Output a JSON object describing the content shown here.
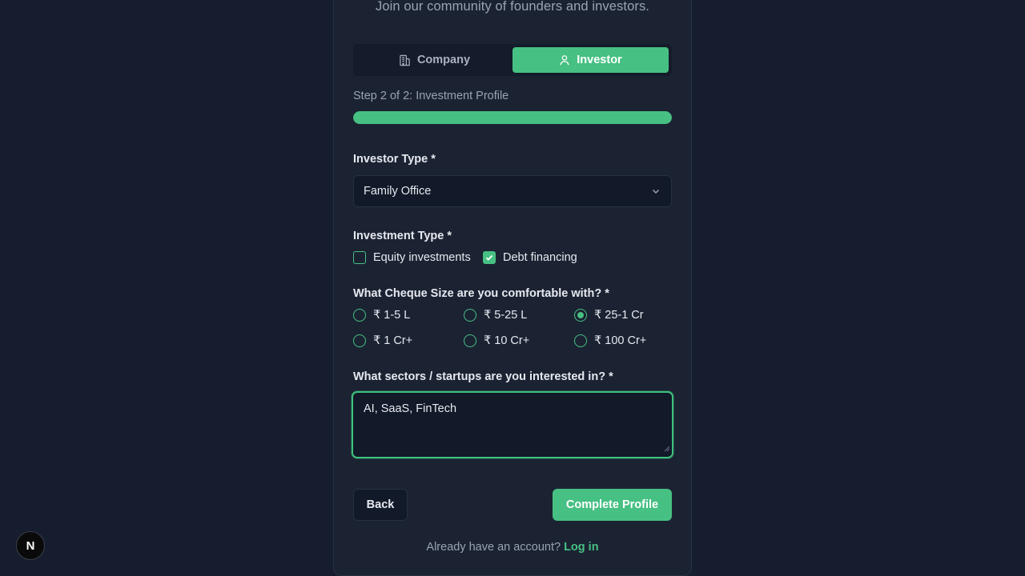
{
  "header": {
    "subtitle": "Join our community of founders and investors."
  },
  "role_toggle": {
    "company_label": "Company",
    "investor_label": "Investor",
    "selected": "Investor"
  },
  "progress": {
    "step_text": "Step 2 of 2: Investment Profile",
    "fraction": 1.0
  },
  "investor_type": {
    "label": "Investor Type *",
    "value": "Family Office"
  },
  "investment_type": {
    "label": "Investment Type *",
    "options": [
      {
        "label": "Equity investments",
        "checked": false
      },
      {
        "label": "Debt financing",
        "checked": true
      }
    ]
  },
  "cheque_size": {
    "label": "What Cheque Size are you comfortable with? *",
    "options": [
      {
        "label": "₹ 1-5 L",
        "selected": false
      },
      {
        "label": "₹ 5-25 L",
        "selected": false
      },
      {
        "label": "₹ 25-1 Cr",
        "selected": true
      },
      {
        "label": "₹ 1 Cr+",
        "selected": false
      },
      {
        "label": "₹ 10 Cr+",
        "selected": false
      },
      {
        "label": "₹ 100 Cr+",
        "selected": false
      }
    ]
  },
  "sectors": {
    "label": "What sectors / startups are you interested in? *",
    "value": "AI, SaaS, FinTech"
  },
  "actions": {
    "back_label": "Back",
    "submit_label": "Complete Profile"
  },
  "footer": {
    "prompt": "Already have an account?",
    "link_label": "Log in"
  },
  "badge": {
    "letter": "N"
  },
  "colors": {
    "accent": "#47c083",
    "background": "#161d2e",
    "card": "#1b2333"
  }
}
